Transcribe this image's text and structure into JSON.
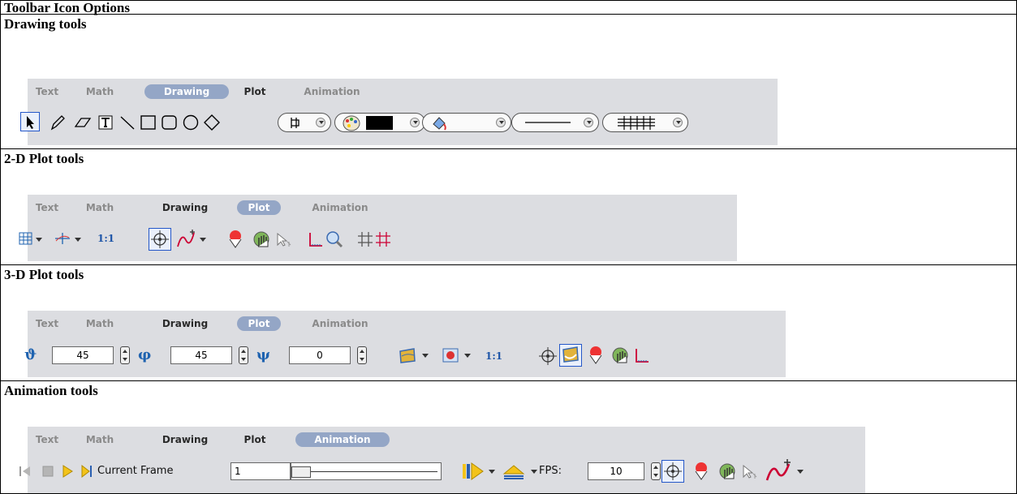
{
  "header": {
    "title": "Toolbar Icon Options"
  },
  "sections": {
    "drawing": {
      "title": "Drawing tools"
    },
    "plot2d": {
      "title": "2-D Plot tools"
    },
    "plot3d": {
      "title": "3-D Plot tools"
    },
    "animation": {
      "title": "Animation tools"
    }
  },
  "tabs": [
    "Text",
    "Math",
    "Drawing",
    "Plot",
    "Animation"
  ],
  "colors": {
    "selected_outline": "#2457c8",
    "active_tab": "#94a6c6",
    "toolbar_bg": "#dcdde1"
  },
  "plot3d": {
    "theta": "45",
    "phi": "45",
    "psi": "0",
    "one_to_one": "1:1"
  },
  "plot2d": {
    "one_to_one": "1:1"
  },
  "animation": {
    "current_frame_label": "Current Frame",
    "current_frame": "1",
    "fps_label": "FPS:",
    "fps": "10"
  }
}
